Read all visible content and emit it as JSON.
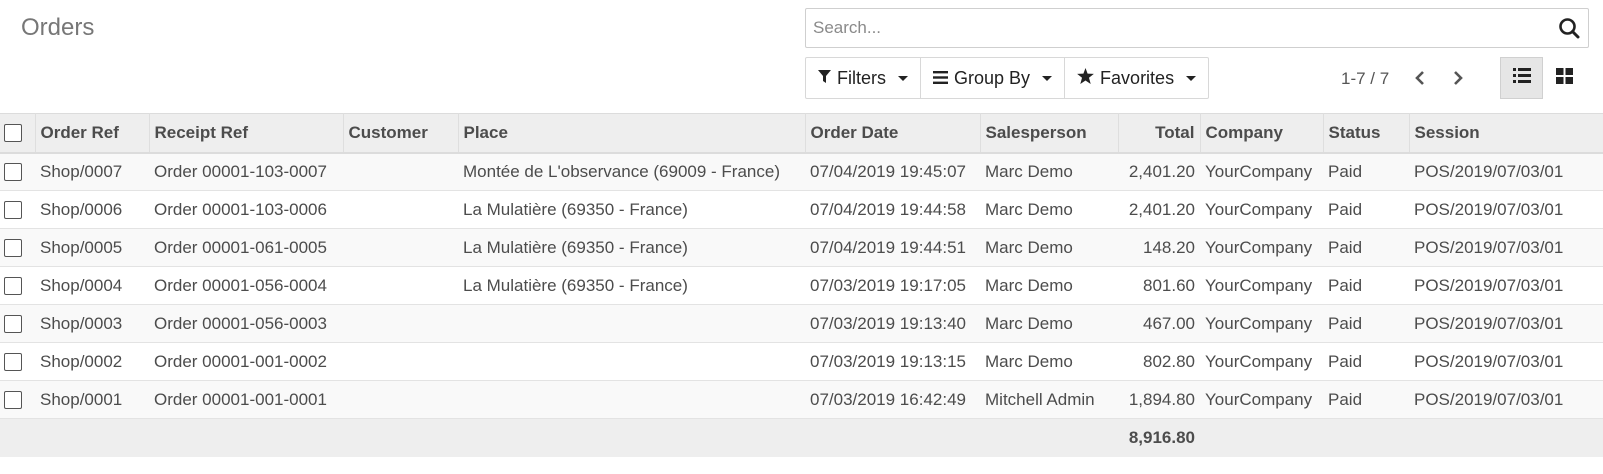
{
  "header": {
    "title": "Orders"
  },
  "search": {
    "placeholder": "Search...",
    "value": ""
  },
  "controls": {
    "filters_label": "Filters",
    "groupby_label": "Group By",
    "favorites_label": "Favorites",
    "pager_text": "1-7 / 7",
    "active_view": "list"
  },
  "table": {
    "columns": [
      "Order Ref",
      "Receipt Ref",
      "Customer",
      "Place",
      "Order Date",
      "Salesperson",
      "Total",
      "Company",
      "Status",
      "Session"
    ],
    "rows": [
      {
        "order_ref": "Shop/0007",
        "receipt_ref": "Order 00001-103-0007",
        "customer": "",
        "place": "Montée de L'observance (69009 - France)",
        "order_date": "07/04/2019 19:45:07",
        "salesperson": "Marc Demo",
        "total": "2,401.20",
        "company": "YourCompany",
        "status": "Paid",
        "session": "POS/2019/07/03/01"
      },
      {
        "order_ref": "Shop/0006",
        "receipt_ref": "Order 00001-103-0006",
        "customer": "",
        "place": "La Mulatière (69350 - France)",
        "order_date": "07/04/2019 19:44:58",
        "salesperson": "Marc Demo",
        "total": "2,401.20",
        "company": "YourCompany",
        "status": "Paid",
        "session": "POS/2019/07/03/01"
      },
      {
        "order_ref": "Shop/0005",
        "receipt_ref": "Order 00001-061-0005",
        "customer": "",
        "place": "La Mulatière (69350 - France)",
        "order_date": "07/04/2019 19:44:51",
        "salesperson": "Marc Demo",
        "total": "148.20",
        "company": "YourCompany",
        "status": "Paid",
        "session": "POS/2019/07/03/01"
      },
      {
        "order_ref": "Shop/0004",
        "receipt_ref": "Order 00001-056-0004",
        "customer": "",
        "place": "La Mulatière (69350 - France)",
        "order_date": "07/03/2019 19:17:05",
        "salesperson": "Marc Demo",
        "total": "801.60",
        "company": "YourCompany",
        "status": "Paid",
        "session": "POS/2019/07/03/01"
      },
      {
        "order_ref": "Shop/0003",
        "receipt_ref": "Order 00001-056-0003",
        "customer": "",
        "place": "",
        "order_date": "07/03/2019 19:13:40",
        "salesperson": "Marc Demo",
        "total": "467.00",
        "company": "YourCompany",
        "status": "Paid",
        "session": "POS/2019/07/03/01"
      },
      {
        "order_ref": "Shop/0002",
        "receipt_ref": "Order 00001-001-0002",
        "customer": "",
        "place": "",
        "order_date": "07/03/2019 19:13:15",
        "salesperson": "Marc Demo",
        "total": "802.80",
        "company": "YourCompany",
        "status": "Paid",
        "session": "POS/2019/07/03/01"
      },
      {
        "order_ref": "Shop/0001",
        "receipt_ref": "Order 00001-001-0001",
        "customer": "",
        "place": "",
        "order_date": "07/03/2019 16:42:49",
        "salesperson": "Mitchell Admin",
        "total": "1,894.80",
        "company": "YourCompany",
        "status": "Paid",
        "session": "POS/2019/07/03/01"
      }
    ],
    "footer_total": "8,916.80"
  }
}
